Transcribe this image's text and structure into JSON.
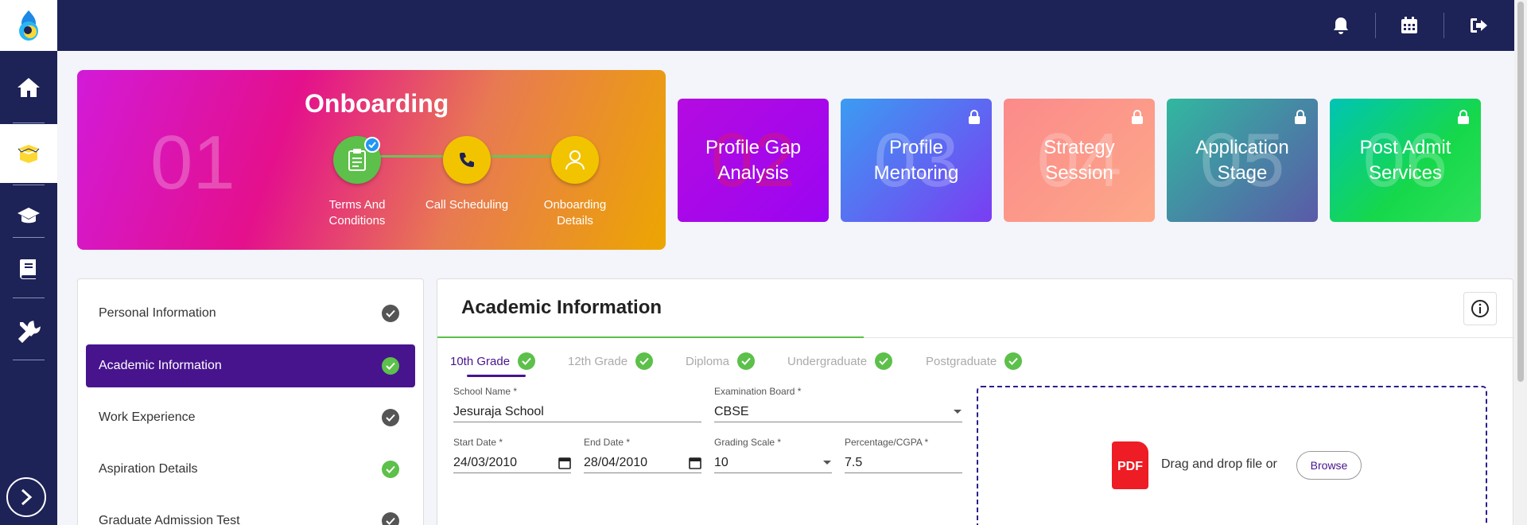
{
  "onboarding": {
    "number": "01",
    "title": "Onboarding",
    "steps": [
      {
        "label": "Terms And Conditions",
        "color": "#5cc04a",
        "icon": "clipboard-icon"
      },
      {
        "label": "Call Scheduling",
        "color": "#f2c400",
        "icon": "phone-icon"
      },
      {
        "label": "Onboarding Details",
        "color": "#f2c400",
        "icon": "user-icon"
      }
    ]
  },
  "stages": [
    {
      "number": "02",
      "label": "Profile Gap Analysis",
      "locked": false
    },
    {
      "number": "03",
      "label": "Profile Mentoring",
      "locked": true
    },
    {
      "number": "04",
      "label": "Strategy Session",
      "locked": true
    },
    {
      "number": "05",
      "label": "Application Stage",
      "locked": true
    },
    {
      "number": "06",
      "label": "Post Admit Services",
      "locked": true
    }
  ],
  "side_menu": [
    {
      "label": "Personal Information",
      "status": "done-grey"
    },
    {
      "label": "Academic Information",
      "status": "done-green"
    },
    {
      "label": "Work Experience",
      "status": "done-grey"
    },
    {
      "label": "Aspiration Details",
      "status": "done-green"
    },
    {
      "label": "Graduate Admission Test",
      "status": "done-grey"
    }
  ],
  "panel": {
    "title": "Academic Information",
    "tabs": [
      "10th Grade",
      "12th Grade",
      "Diploma",
      "Undergraduate",
      "Postgraduate"
    ],
    "fields": {
      "school_name": {
        "label": "School Name *",
        "value": "Jesuraja School"
      },
      "exam_board": {
        "label": "Examination Board *",
        "value": "CBSE"
      },
      "start_date": {
        "label": "Start Date *",
        "value": "24/03/2010"
      },
      "end_date": {
        "label": "End Date *",
        "value": "28/04/2010"
      },
      "grading_scale": {
        "label": "Grading Scale *",
        "value": "10"
      },
      "percentage": {
        "label": "Percentage/CGPA *",
        "value": "7.5"
      }
    },
    "upload": {
      "icon_text": "PDF",
      "text": "Drag and drop file or",
      "browse_label": "Browse"
    }
  },
  "colors": {
    "navy": "#1d2257",
    "accent_purple": "#47148e",
    "green": "#5cc04a"
  }
}
